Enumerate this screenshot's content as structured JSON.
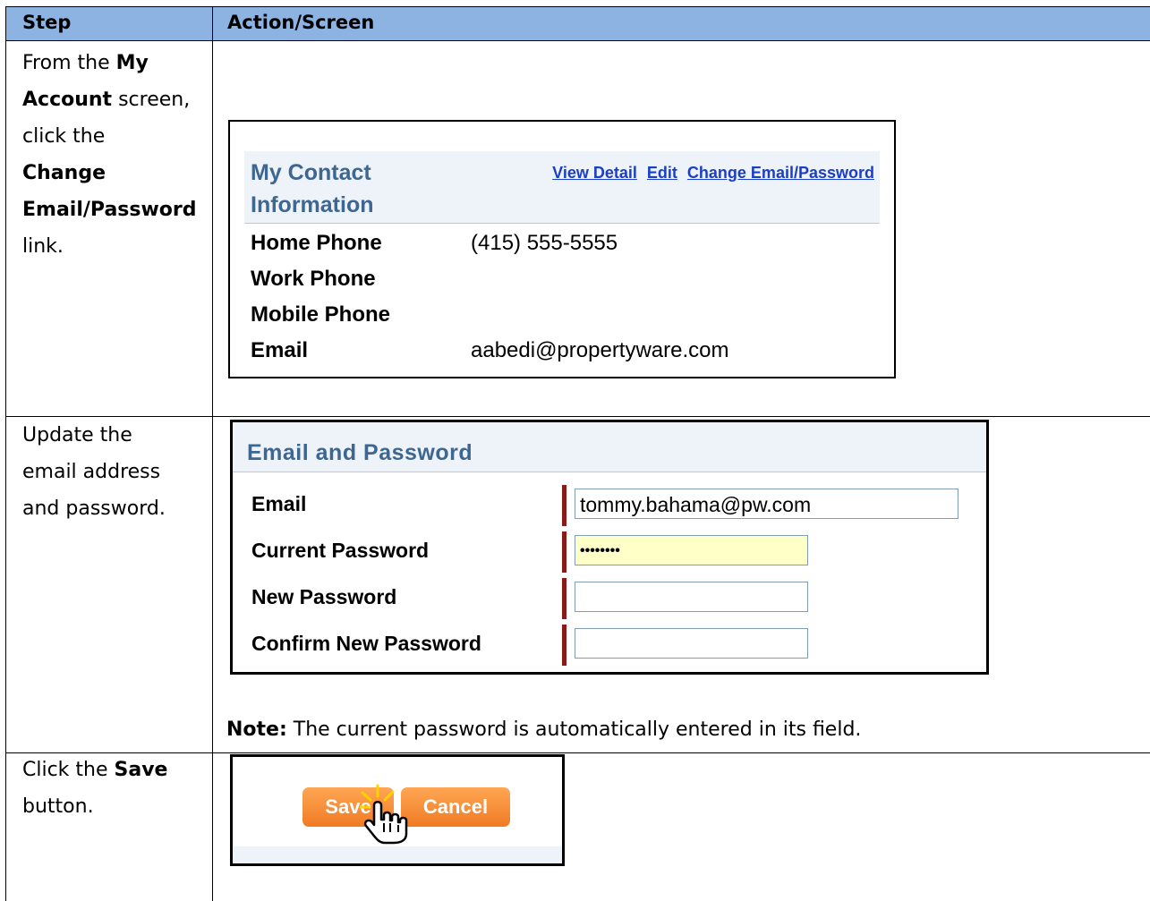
{
  "table": {
    "headers": {
      "step": "Step",
      "action": "Action/Screen"
    },
    "rows": [
      {
        "step_lines": [
          {
            "parts": [
              {
                "t": "From the "
              },
              {
                "t": "My",
                "b": true
              }
            ]
          },
          {
            "parts": [
              {
                "t": "Account",
                "b": true
              },
              {
                "t": " screen,"
              }
            ]
          },
          {
            "parts": [
              {
                "t": "click the"
              }
            ]
          },
          {
            "parts": [
              {
                "t": "Change",
                "b": true
              }
            ]
          },
          {
            "parts": [
              {
                "t": "Email/Password",
                "b": true
              }
            ]
          },
          {
            "parts": [
              {
                "t": "link."
              }
            ]
          }
        ]
      },
      {
        "step_lines": [
          {
            "parts": [
              {
                "t": "Update the"
              }
            ]
          },
          {
            "parts": [
              {
                "t": "email address"
              }
            ]
          },
          {
            "parts": [
              {
                "t": "and password."
              }
            ]
          }
        ]
      },
      {
        "step_lines": [
          {
            "parts": [
              {
                "t": "Click the "
              },
              {
                "t": "Save",
                "b": true
              }
            ]
          },
          {
            "parts": [
              {
                "t": "button."
              }
            ]
          }
        ]
      }
    ]
  },
  "contact": {
    "title": "My Contact Information",
    "links": [
      "View Detail",
      "Edit",
      "Change Email/Password"
    ],
    "fields": [
      {
        "label": "Home Phone",
        "value": "(415) 555-5555"
      },
      {
        "label": "Work Phone",
        "value": ""
      },
      {
        "label": "Mobile Phone",
        "value": ""
      },
      {
        "label": "Email",
        "value": "aabedi@propertyware.com"
      }
    ]
  },
  "password_form": {
    "title": "Email and Password",
    "fields": [
      {
        "label": "Email",
        "value": "tommy.bahama@pw.com"
      },
      {
        "label": "Current Password",
        "value": "••••••••"
      },
      {
        "label": "New Password",
        "value": ""
      },
      {
        "label": "Confirm New Password",
        "value": ""
      }
    ]
  },
  "note": {
    "label": "Note:",
    "text": "The current password is automatically entered in its field."
  },
  "buttons": {
    "save": "Save",
    "cancel": "Cancel"
  },
  "colors": {
    "header": "#8db3e2",
    "brand_title": "#3d6691",
    "link": "#1a3ec8",
    "button": "#f58a35",
    "required": "#8b1a1a",
    "autofill": "#ffffc8"
  }
}
